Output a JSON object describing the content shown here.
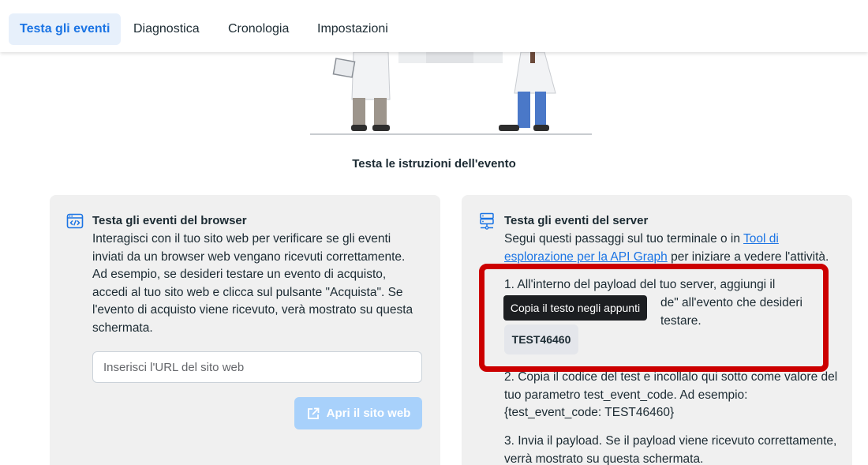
{
  "tabs": [
    {
      "label": "Testa gli eventi",
      "active": true
    },
    {
      "label": "Diagnostica",
      "active": false
    },
    {
      "label": "Cronologia",
      "active": false
    },
    {
      "label": "Impostazioni",
      "active": false
    }
  ],
  "instructions_title": "Testa le istruzioni dell'evento",
  "browser_card": {
    "icon": "code-window-icon",
    "title": "Testa gli eventi del browser",
    "description": "Interagisci con il tuo sito web per verificare se gli eventi inviati da un browser web vengano ricevuti correttamente. Ad esempio, se desideri testare un evento di acquisto, accedi al tuo sito web e clicca sul pulsante \"Acquista\". Se l'evento di acquisto viene ricevuto, verà mostrato su questa schermata.",
    "url_placeholder": "Inserisci l'URL del sito web",
    "open_button": "Apri il sito web",
    "open_icon": "external-link-icon"
  },
  "server_card": {
    "icon": "server-icon",
    "title": "Testa gli eventi del server",
    "intro_before": "Segui questi passaggi sul tuo terminale o in ",
    "intro_link": "Tool di esplorazione per la API Graph",
    "intro_after": " per iniziare a vedere l'attività.",
    "step1_line1": "1. All'interno del payload del tuo server, aggiungi il",
    "step1_line2": "de\" all'evento che desideri testare.",
    "test_code": "TEST46460",
    "step2": "2. Copia il codice del test e incollalo qui sotto come valore del tuo parametro test_event_code. Ad esempio: {test_event_code: TEST46460}",
    "step3": "3. Invia il payload. Se il payload viene ricevuto correttamente, verrà mostrato su questa schermata."
  },
  "tooltip": "Copia il testo negli appunti",
  "colors": {
    "accent": "#1b74e4",
    "highlight": "#cc0000",
    "tab_active_bg": "#e7f0fb",
    "button_disabled": "#a8d1fb"
  }
}
